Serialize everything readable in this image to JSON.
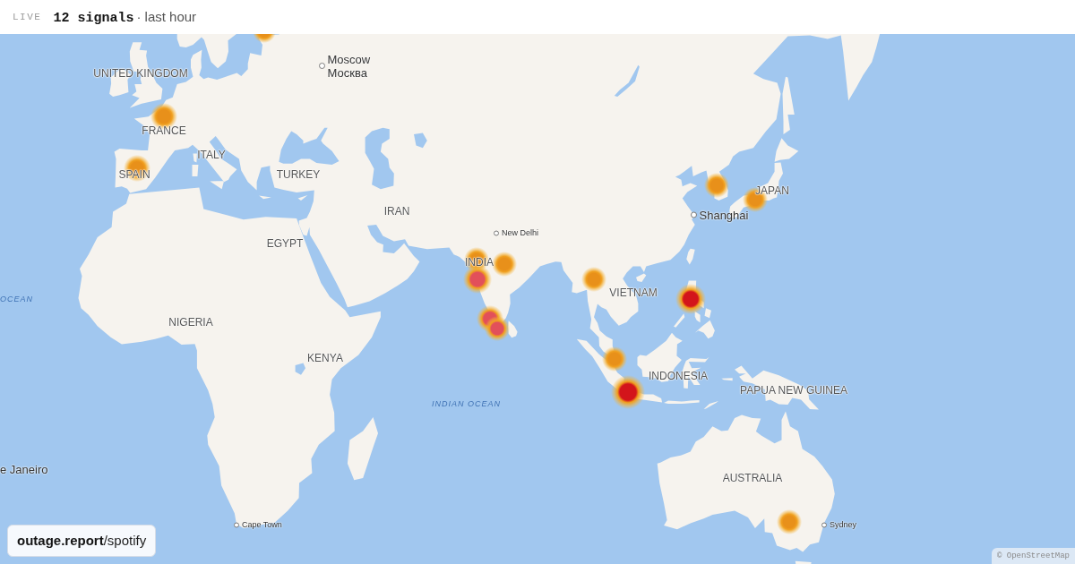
{
  "header": {
    "status": "LIVE",
    "count": "12 signals",
    "period": "· last hour"
  },
  "map": {
    "countries": [
      {
        "text": "UNITED KINGDOM"
      },
      {
        "text": "FRANCE"
      },
      {
        "text": "ITALY"
      },
      {
        "text": "SPAIN"
      },
      {
        "text": "TURKEY"
      },
      {
        "text": "JAPAN"
      },
      {
        "text": "IRAN"
      },
      {
        "text": "EGYPT"
      },
      {
        "text": "INDIA"
      },
      {
        "text": "VIETNAM"
      },
      {
        "text": "NIGERIA"
      },
      {
        "text": "KENYA"
      },
      {
        "text": "INDONESIA"
      },
      {
        "text": "PAPUA NEW GUINEA"
      },
      {
        "text": "AUSTRALIA"
      }
    ],
    "places": [
      {
        "kind": "city",
        "text": "Moscow",
        "subtext": "Москва",
        "marker": true
      },
      {
        "kind": "city",
        "text": "Shanghai",
        "marker": true
      },
      {
        "kind": "town",
        "text": "New Delhi",
        "marker": true
      },
      {
        "kind": "city",
        "text": "e Janeiro",
        "marker": false
      },
      {
        "kind": "town",
        "text": "Cape Town",
        "marker": true
      },
      {
        "kind": "town",
        "text": "Sydney",
        "marker": true
      }
    ],
    "oceans": [
      {
        "text": "OCEAN"
      },
      {
        "text": "INDIAN OCEAN"
      }
    ],
    "hotspots": [
      {
        "color": "#e8901a"
      },
      {
        "color": "#e8901a"
      },
      {
        "color": "#e8901a"
      },
      {
        "color": "#e8901a"
      },
      {
        "color": "#e8901a"
      },
      {
        "color": "#e8901a"
      },
      {
        "color": "#e8901a"
      },
      {
        "color": "#e2505a"
      },
      {
        "color": "#e2505a"
      },
      {
        "color": "#e2505a"
      },
      {
        "color": "#e8901a"
      },
      {
        "color": "#d3151b"
      },
      {
        "color": "#e8901a"
      },
      {
        "color": "#d3151b"
      },
      {
        "color": "#e8901a"
      }
    ]
  },
  "site_badge": "**outage.report**/spotify",
  "attribution": "© OpenStreetMap"
}
